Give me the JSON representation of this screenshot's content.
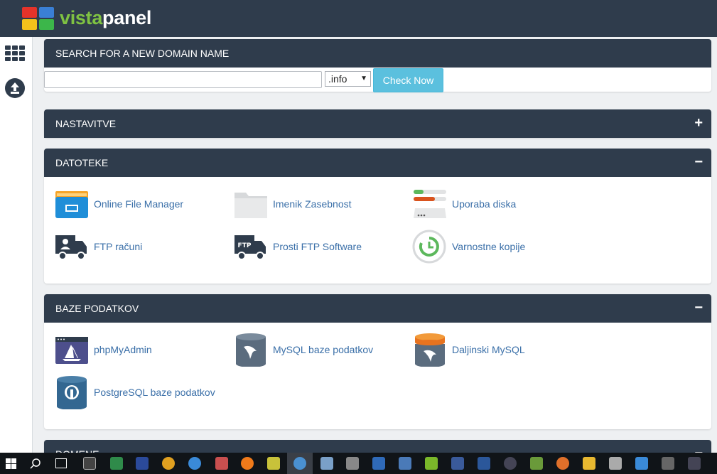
{
  "app": {
    "logo_part1": "vista",
    "logo_part2": "panel"
  },
  "search": {
    "header": "SEARCH FOR A NEW DOMAIN NAME",
    "input_value": "",
    "tld_selected": ".info",
    "button_label": "Check Now"
  },
  "sections": {
    "nastavitve": {
      "title": "NASTAVITVE",
      "toggle": "+"
    },
    "datoteke": {
      "title": "DATOTEKE",
      "toggle": "−",
      "items": [
        {
          "label": "Online File Manager",
          "icon": "file-manager-icon"
        },
        {
          "label": "Imenik Zasebnost",
          "icon": "folder-privacy-icon"
        },
        {
          "label": "Uporaba diska",
          "icon": "disk-usage-icon"
        },
        {
          "label": "FTP računi",
          "icon": "ftp-accounts-icon"
        },
        {
          "label": "Prosti FTP Software",
          "icon": "ftp-software-icon"
        },
        {
          "label": "Varnostne kopije",
          "icon": "backup-icon"
        }
      ]
    },
    "baze": {
      "title": "BAZE PODATKOV",
      "toggle": "−",
      "items": [
        {
          "label": "phpMyAdmin",
          "icon": "phpmyadmin-icon"
        },
        {
          "label": "MySQL baze podatkov",
          "icon": "mysql-db-icon"
        },
        {
          "label": "Daljinski MySQL",
          "icon": "remote-mysql-icon"
        },
        {
          "label": "PostgreSQL baze podatkov",
          "icon": "postgresql-icon"
        }
      ]
    },
    "domene": {
      "title": "DOMENE",
      "toggle": "−"
    }
  },
  "colors": {
    "header_bg": "#2f3c4c",
    "link": "#3a6fa8",
    "button": "#5bc0de",
    "logo_green": "#7fc242"
  }
}
